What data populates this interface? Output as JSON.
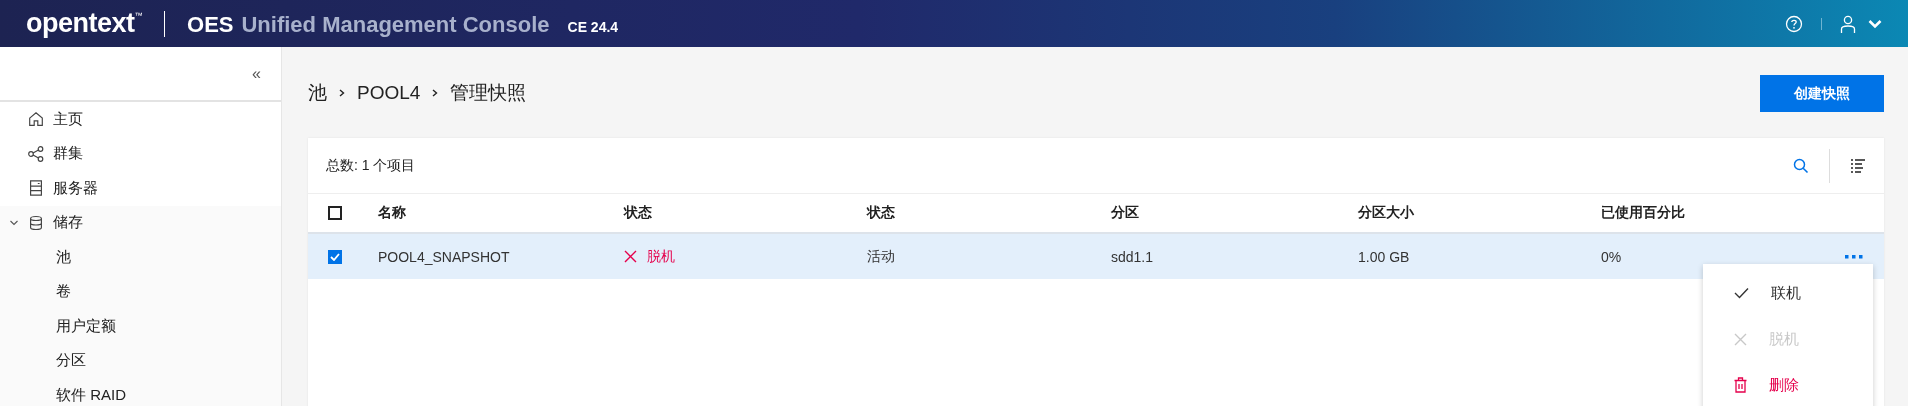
{
  "header": {
    "logo": "opentext",
    "logo_mark": "™",
    "product": "OES",
    "title": "Unified Management Console",
    "version": "CE 24.4"
  },
  "sidebar": {
    "collapse": "«",
    "items": [
      {
        "label": "主页",
        "kind": "home",
        "selected": false
      },
      {
        "label": "群集",
        "kind": "share",
        "selected": false
      },
      {
        "label": "服务器",
        "kind": "server",
        "selected": false
      },
      {
        "label": "储存",
        "kind": "database",
        "selected": false,
        "expanded": true,
        "children": [
          {
            "label": "池",
            "selected": false
          },
          {
            "label": "卷",
            "selected": false
          },
          {
            "label": "用户定额",
            "selected": false
          },
          {
            "label": "分区",
            "selected": false
          },
          {
            "label": "软件 RAID",
            "selected": false
          }
        ]
      }
    ]
  },
  "breadcrumb": [
    "池",
    "POOL4",
    "管理快照"
  ],
  "create_button": "创建快照",
  "table": {
    "total": "总数: 1 个项目",
    "all_checked": false,
    "columns": [
      "名称",
      "状态",
      "状态",
      "分区",
      "分区大小",
      "已使用百分比"
    ],
    "rows": [
      {
        "checked": true,
        "name": "POOL4_SNAPSHOT",
        "status": {
          "kind": "offline",
          "text": "脱机"
        },
        "state": "活动",
        "partition": "sdd1.1",
        "size": "1.00 GB",
        "used": "0%"
      }
    ]
  },
  "row_menu": [
    {
      "kind": "check",
      "label": "联机",
      "disabled": false
    },
    {
      "kind": "cross",
      "label": "脱机",
      "disabled": true
    },
    {
      "kind": "delete",
      "label": "删除",
      "disabled": false
    }
  ]
}
